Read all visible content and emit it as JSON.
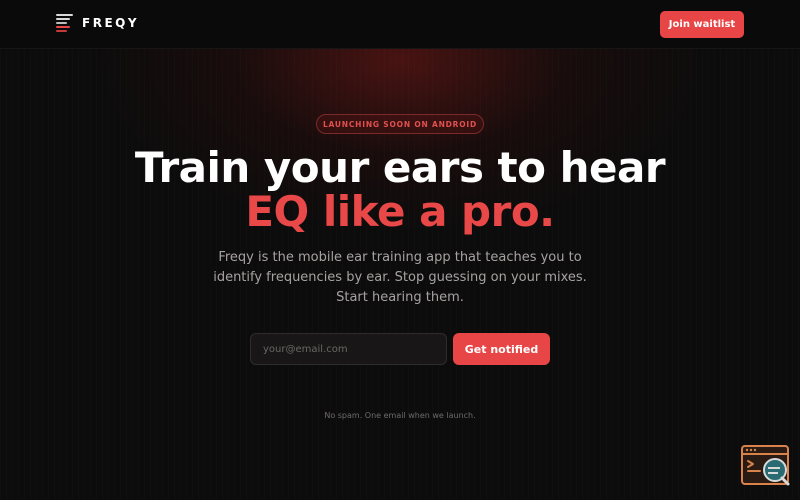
{
  "brand": {
    "name": "FREQY",
    "logo_icon": "equalizer-bars-icon",
    "accent_color": "#e84646"
  },
  "header": {
    "cta_label": "Join waitlist"
  },
  "hero": {
    "badge": "LAUNCHING SOON ON ANDROID",
    "headline_line1": "Train your ears to hear",
    "headline_line2": "EQ like a pro.",
    "description_lines": [
      "Freqy is the mobile ear training app that teaches you to",
      "identify frequencies by ear. Stop guessing on your mixes.",
      "Start hearing them."
    ]
  },
  "signup": {
    "email_placeholder": "your@email.com",
    "email_value": "",
    "submit_label": "Get notified",
    "fineprint": "No spam. One email when we launch."
  },
  "corner_widget": {
    "icon": "browser-inspect-icon"
  }
}
